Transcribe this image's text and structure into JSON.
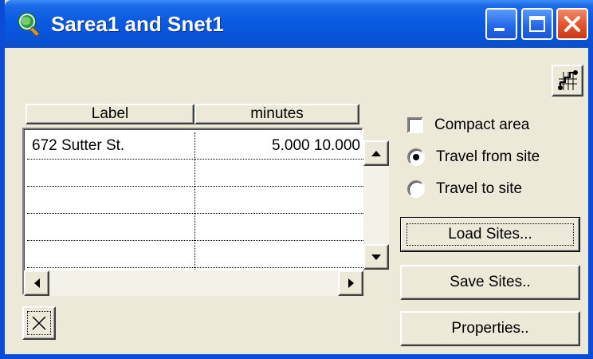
{
  "window": {
    "title": "Sarea1 and Snet1",
    "title_icon": "globe-magnifier-icon",
    "colors": {
      "titlebar": "#0a5ae2",
      "face": "#ece9d8",
      "close": "#e4522b"
    }
  },
  "toolbar": {
    "network_icon": "network-grid-icon"
  },
  "table": {
    "columns": [
      "Label",
      "minutes"
    ],
    "rows": [
      [
        "672 Sutter St.",
        "5.000 10.000"
      ],
      [
        "",
        ""
      ],
      [
        "",
        ""
      ],
      [
        "",
        ""
      ],
      [
        "",
        ""
      ]
    ]
  },
  "options": {
    "compact_area": {
      "label": "Compact area",
      "checked": false
    },
    "travel_from_site": {
      "label": "Travel from site",
      "selected": true
    },
    "travel_to_site": {
      "label": "Travel to site",
      "selected": false
    }
  },
  "buttons": {
    "load_sites": "Load Sites...",
    "save_sites": "Save Sites..",
    "properties": "Properties.."
  },
  "bottom": {
    "clear_icon": "clear-x-icon"
  }
}
